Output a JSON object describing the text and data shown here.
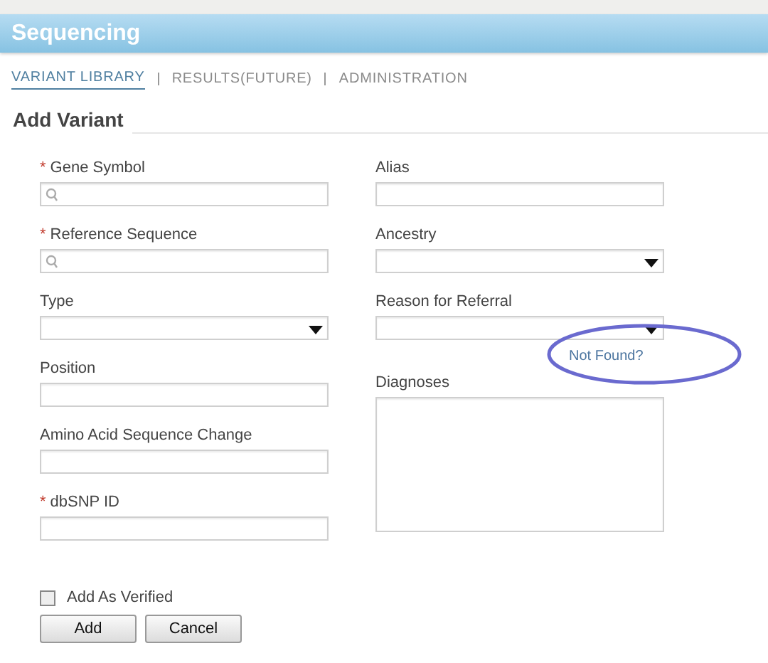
{
  "header": {
    "title": "Sequencing"
  },
  "nav": [
    {
      "label": "VARIANT LIBRARY",
      "selected": true
    },
    {
      "label": "RESULTS(FUTURE)",
      "selected": false
    },
    {
      "label": "ADMINISTRATION",
      "selected": false
    }
  ],
  "section_title": "Add Variant",
  "left_fields": [
    {
      "label": "Gene Symbol",
      "required": true,
      "kind": "search"
    },
    {
      "label": "Reference Sequence",
      "required": true,
      "kind": "search"
    },
    {
      "label": "Type",
      "required": false,
      "kind": "select"
    },
    {
      "label": "Position",
      "required": false,
      "kind": "text"
    },
    {
      "label": "Amino Acid Sequence Change",
      "required": false,
      "kind": "text"
    },
    {
      "label": "dbSNP ID",
      "required": true,
      "kind": "text"
    }
  ],
  "right_fields": [
    {
      "label": "Alias",
      "required": false,
      "kind": "text"
    },
    {
      "label": "Ancestry",
      "required": false,
      "kind": "select"
    },
    {
      "label": "Reason for Referral",
      "required": false,
      "kind": "select",
      "link": "Not Found?"
    },
    {
      "label": "Diagnoses",
      "required": false,
      "kind": "textarea"
    }
  ],
  "required_mark": "*",
  "verified": {
    "label": "Add As Verified",
    "checked": false
  },
  "buttons": [
    "Add",
    "Cancel"
  ]
}
